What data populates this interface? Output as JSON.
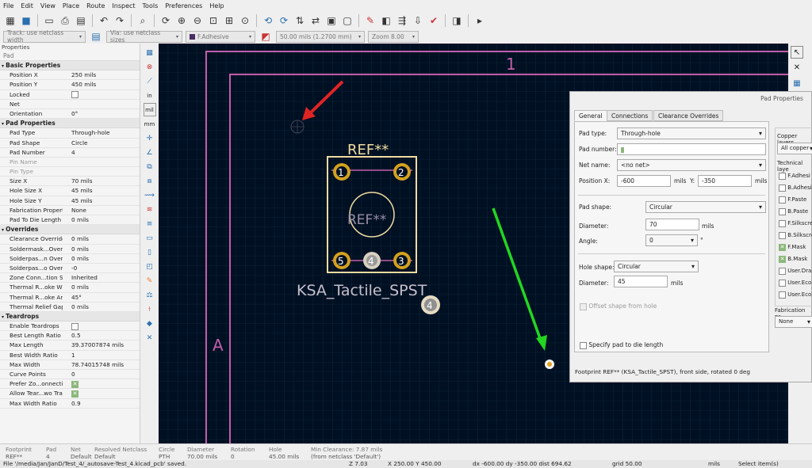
{
  "menu": [
    "File",
    "Edit",
    "View",
    "Place",
    "Route",
    "Inspect",
    "Tools",
    "Preferences",
    "Help"
  ],
  "toolbar2": {
    "track": "Track: use netclass width",
    "via": "Via: use netclass sizes",
    "layer": "F.Adhesive",
    "grid": "50.00 mils (1.2700 mm)",
    "zoom": "Zoom 8.00"
  },
  "props": {
    "panel_title": "Properties",
    "subtitle": "Pad",
    "sections": [
      {
        "title": "Basic Properties",
        "rows": [
          [
            "Position X",
            "250 mils"
          ],
          [
            "Position Y",
            "450 mils"
          ],
          [
            "Locked",
            "cb0"
          ],
          [
            "Net",
            ""
          ],
          [
            "Orientation",
            "0°"
          ]
        ]
      },
      {
        "title": "Pad Properties",
        "rows": [
          [
            "Pad Type",
            "Through-hole"
          ],
          [
            "Pad Shape",
            "Circle"
          ],
          [
            "Pad Number",
            "4"
          ],
          [
            "Pin Name",
            "",
            "dis"
          ],
          [
            "Pin Type",
            "",
            "dis"
          ],
          [
            "Size X",
            "70 mils"
          ],
          [
            "Hole Size X",
            "45 mils"
          ],
          [
            "Hole Size Y",
            "45 mils"
          ],
          [
            "Fabrication Property",
            "None"
          ],
          [
            "Pad To Die Length",
            "0 mils"
          ]
        ]
      },
      {
        "title": "Overrides",
        "rows": [
          [
            "Clearance Override",
            "0 mils"
          ],
          [
            "Soldermask...Override",
            "0 mils"
          ],
          [
            "Solderpas...n Override",
            "0 mils"
          ],
          [
            "Solderpas...o Override",
            "-0"
          ],
          [
            "Zone Conn...tion Style",
            "Inherited"
          ],
          [
            "Thermal R...oke Width",
            "0 mils"
          ],
          [
            "Thermal R...oke Angle",
            "45°"
          ],
          [
            "Thermal Relief Gap",
            "0 mils"
          ]
        ]
      },
      {
        "title": "Teardrops",
        "rows": [
          [
            "Enable Teardrops",
            "cb0"
          ],
          [
            "Best Length Ratio",
            "0.5"
          ],
          [
            "Max Length",
            "39.37007874 mils"
          ],
          [
            "Best Width Ratio",
            "1"
          ],
          [
            "Max Width",
            "78.74015748 mils"
          ],
          [
            "Curve Points",
            "0"
          ],
          [
            "Prefer Zo...onnections",
            "cb1"
          ],
          [
            "Allow Tear...wo Tracks",
            "cb1"
          ],
          [
            "Max Width Ratio",
            "0.9"
          ]
        ]
      }
    ]
  },
  "canvas": {
    "ref": "REF**",
    "ref_center": "REF**",
    "value": "KSA_Tactile_SPST",
    "frame_col": "1",
    "frame_row": "A",
    "pads": [
      "1",
      "2",
      "3",
      "4",
      "5"
    ],
    "pad_free": "4"
  },
  "dialog": {
    "title": "Pad Properties",
    "tabs": [
      "General",
      "Connections",
      "Clearance Overrides"
    ],
    "pad_type_label": "Pad type:",
    "pad_type": "Through-hole",
    "pad_number_label": "Pad number:",
    "pad_number": "",
    "net_name_label": "Net name:",
    "net_name": "<no net>",
    "position_x_label": "Position X:",
    "position_x": "-600",
    "pos_x_unit": "mils",
    "position_y_label": "Y:",
    "position_y": "-350",
    "pos_y_unit": "mils",
    "pad_shape_label": "Pad shape:",
    "pad_shape": "Circular",
    "diameter_label": "Diameter:",
    "diameter": "70",
    "diameter_unit": "mils",
    "angle_label": "Angle:",
    "angle": "0",
    "angle_unit": "°",
    "hole_shape_label": "Hole shape:",
    "hole_shape": "Circular",
    "hole_diameter_label": "Diameter:",
    "hole_diameter": "45",
    "hole_diameter_unit": "mils",
    "offset_label": "Offset shape from hole",
    "die_length_label": "Specify pad to die length",
    "footprint_info": "Footprint REF** (KSA_Tactile_SPST), front side, rotated 0 deg",
    "copper_layers_label": "Copper layers",
    "copper_layers": "All copper",
    "technical_layers_label": "Technical laye",
    "layers": [
      [
        "F.Adhesi",
        false
      ],
      [
        "B.Adhesi",
        false
      ],
      [
        "F.Paste",
        false
      ],
      [
        "B.Paste",
        false
      ],
      [
        "F.Silkscre",
        false
      ],
      [
        "B.Silkscre",
        false
      ],
      [
        "F.Mask",
        true
      ],
      [
        "B.Mask",
        true
      ],
      [
        "User.Dra",
        false
      ],
      [
        "User.Eco",
        false
      ],
      [
        "User.Eco",
        false
      ]
    ],
    "fab_label": "Fabrication pr",
    "fab_value": "None"
  },
  "status": [
    [
      "Footprint",
      "REF**"
    ],
    [
      "Pad",
      "4"
    ],
    [
      "Net",
      "Default"
    ],
    [
      "Resolved Netclass",
      "Default"
    ],
    [
      "Circle",
      "PTH"
    ],
    [
      "Diameter",
      "70.00 mils"
    ],
    [
      "Rotation",
      "0"
    ],
    [
      "Hole",
      "45.00 mils"
    ],
    [
      "Min Clearance: 7.87 mils",
      "(from netclass 'Default')"
    ]
  ],
  "statusbar": {
    "file": "File '/media/Jan/JanD/Test_4/_autosave-Test_4.kicad_pcb' saved.",
    "z": "Z 7.03",
    "xy": "X 250.00  Y 450.00",
    "dxy": "dx -600.00  dy -350.00  dist 694.62",
    "grid": "grid 50.00",
    "units": "mils",
    "mode": "Select item(s)"
  }
}
